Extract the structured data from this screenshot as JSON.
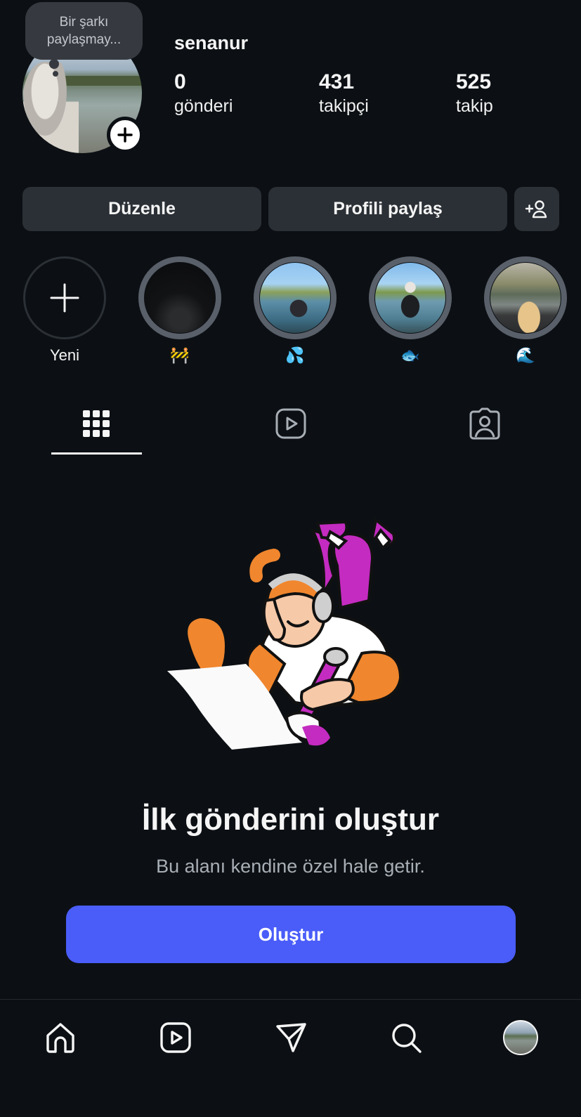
{
  "profile": {
    "note": "Bir şarkı paylaşmay...",
    "username": "senanur",
    "stats": [
      {
        "value": "0",
        "label": "gönderi"
      },
      {
        "value": "431",
        "label": "takipçi"
      },
      {
        "value": "525",
        "label": "takip"
      }
    ]
  },
  "actions": {
    "edit_label": "Düzenle",
    "share_label": "Profili paylaş"
  },
  "highlights": [
    {
      "label": "Yeni",
      "icon": "plus-icon"
    },
    {
      "label": "🚧",
      "icon": "night-road-thumbnail"
    },
    {
      "label": "💦",
      "icon": "lake-portrait-thumbnail"
    },
    {
      "label": "🐟",
      "icon": "lake-portrait-thumbnail"
    },
    {
      "label": "🌊",
      "icon": "lake-picnic-thumbnail"
    }
  ],
  "tabs": [
    {
      "name": "posts",
      "icon": "grid-icon",
      "active": true
    },
    {
      "name": "reels",
      "icon": "reels-icon",
      "active": false
    },
    {
      "name": "tagged",
      "icon": "tagged-icon",
      "active": false
    }
  ],
  "empty_state": {
    "title": "İlk gönderini oluştur",
    "subtitle": "Bu alanı kendine özel hale getir.",
    "button_label": "Oluştur"
  },
  "bottom_nav": [
    {
      "name": "home",
      "icon": "home-icon"
    },
    {
      "name": "reels",
      "icon": "reels-icon"
    },
    {
      "name": "direct",
      "icon": "paper-plane-icon"
    },
    {
      "name": "search",
      "icon": "search-icon"
    },
    {
      "name": "profile",
      "icon": "avatar"
    }
  ],
  "colors": {
    "background": "#0c1014",
    "button": "#2b3036",
    "accent": "#4a5df9",
    "illustration_orange": "#f0862e",
    "illustration_magenta": "#c42bc0"
  }
}
